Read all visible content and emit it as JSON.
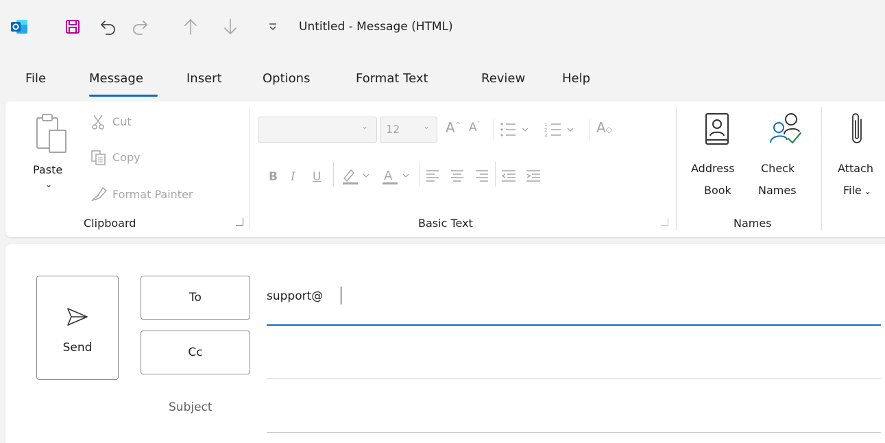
{
  "window": {
    "title": "Untitled  -  Message (HTML)"
  },
  "quick_access": {
    "icons": [
      "outlook-logo-icon",
      "save-icon",
      "undo-icon",
      "redo-icon",
      "previous-item-icon",
      "next-item-icon",
      "customize-quick-access-icon"
    ]
  },
  "tabs": [
    {
      "label": "File"
    },
    {
      "label": "Message"
    },
    {
      "label": "Insert"
    },
    {
      "label": "Options"
    },
    {
      "label": "Format Text"
    },
    {
      "label": "Review"
    },
    {
      "label": "Help"
    }
  ],
  "active_tab": "Message",
  "ribbon": {
    "clipboard": {
      "paste": "Paste",
      "cut": "Cut",
      "copy": "Copy",
      "format_painter": "Format Painter",
      "group_label": "Clipboard"
    },
    "basic_text": {
      "font_size": "12",
      "bold": "B",
      "italic": "I",
      "underline": "U",
      "group_label": "Basic Text"
    },
    "names": {
      "address_book_line1": "Address",
      "address_book_line2": "Book",
      "check_names_line1": "Check",
      "check_names_line2": "Names",
      "group_label": "Names"
    },
    "include": {
      "attach_line1": "Attach",
      "attach_line2": "File"
    }
  },
  "compose": {
    "send_label": "Send",
    "to_label": "To",
    "cc_label": "Cc",
    "subject_label": "Subject",
    "to_value": "support@",
    "cc_value": "",
    "subject_value": ""
  },
  "colors": {
    "accent": "#0f6cbd",
    "save_icon": "#b4009e",
    "outlook_blue": "#0364b8",
    "check_green": "#2e8b57"
  }
}
